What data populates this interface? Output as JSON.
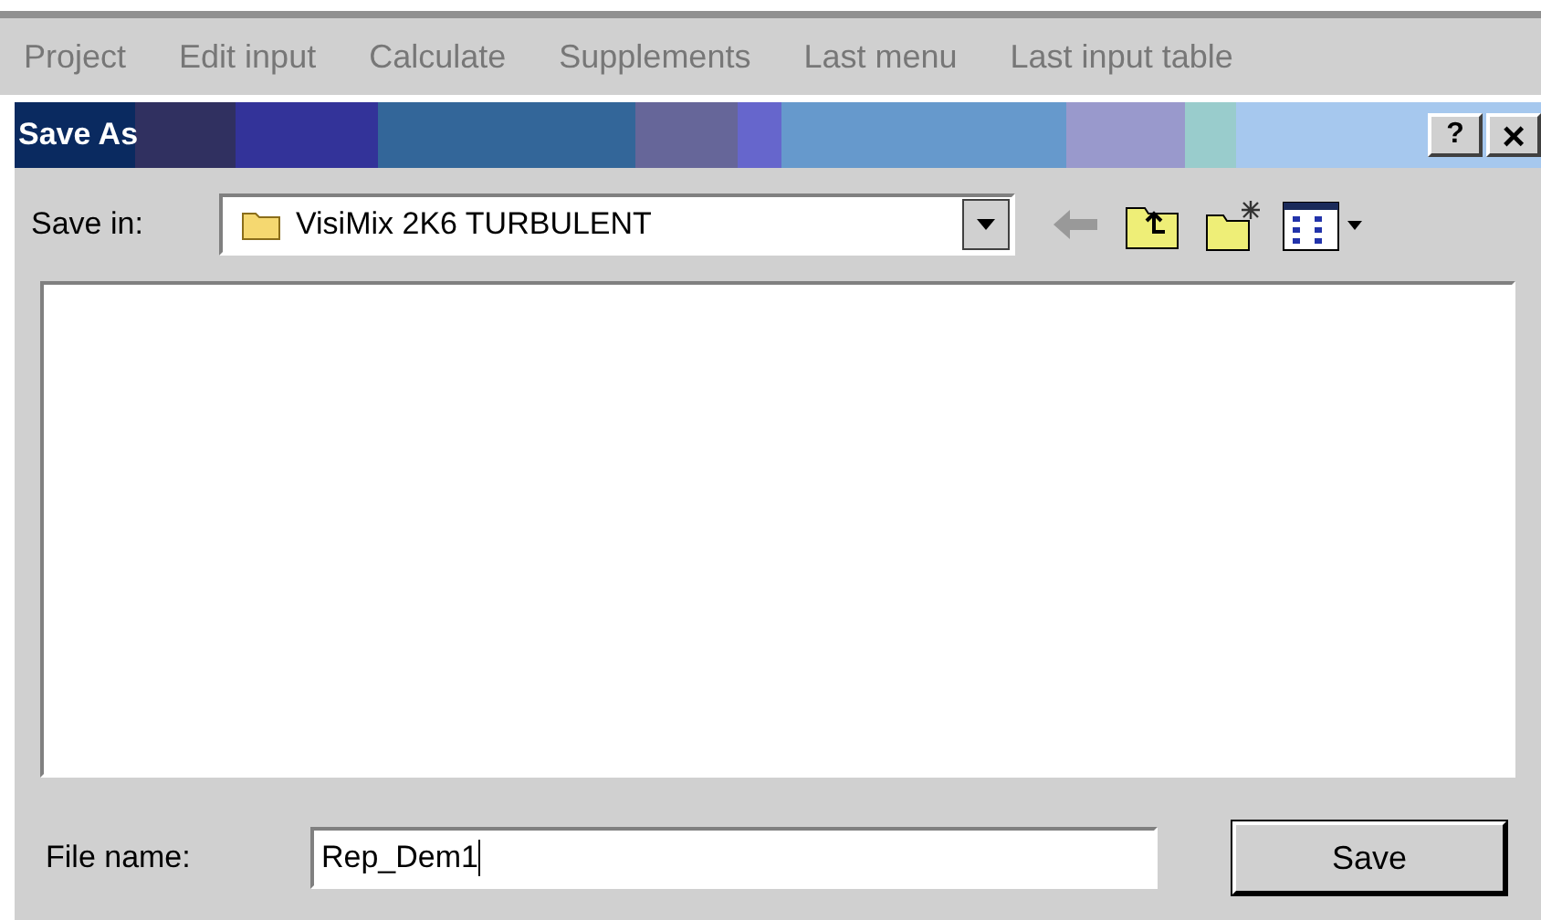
{
  "menu": [
    "Project",
    "Edit input",
    "Calculate",
    "Supplements",
    "Last menu",
    "Last input table"
  ],
  "window": {
    "title": "Save As",
    "help": "?",
    "close": "×"
  },
  "save_in": {
    "label": "Save in:",
    "value": "VisiMix 2K6 TURBULENT"
  },
  "file_name": {
    "label": "File name:",
    "value": "Rep_Dem1"
  },
  "buttons": [
    "Save"
  ]
}
